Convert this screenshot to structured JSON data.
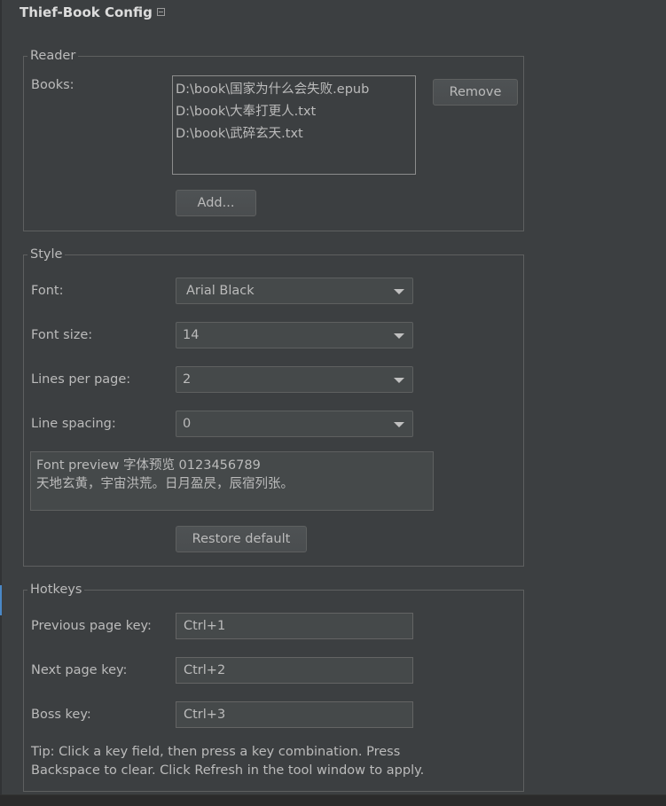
{
  "window": {
    "title": "Thief-Book Config",
    "collapse_icon": "collapse-icon"
  },
  "reader": {
    "legend": "Reader",
    "books_label": "Books:",
    "books": [
      "D:\\book\\国家为什么会失败.epub",
      "D:\\book\\大奉打更人.txt",
      "D:\\book\\武碎玄天.txt"
    ],
    "remove_label": "Remove",
    "add_label": "Add..."
  },
  "style": {
    "legend": "Style",
    "font_label": "Font:",
    "font_value": "Arial Black",
    "font_size_label": "Font size:",
    "font_size_value": "14",
    "lines_label": "Lines per page:",
    "lines_value": "2",
    "spacing_label": "Line spacing:",
    "spacing_value": "0",
    "preview_line1": "Font preview 字体预览 0123456789",
    "preview_line2": "天地玄黄，宇宙洪荒。日月盈昃，辰宿列张。",
    "restore_label": "Restore default"
  },
  "hotkeys": {
    "legend": "Hotkeys",
    "prev_label": "Previous page key:",
    "prev_value": "Ctrl+1",
    "next_label": "Next page key:",
    "next_value": "Ctrl+2",
    "boss_label": "Boss key:",
    "boss_value": "Ctrl+3",
    "tip_line1": "Tip: Click a key field, then press a key combination. Press",
    "tip_line2": "Backspace to clear. Click Refresh in the tool window to apply."
  }
}
